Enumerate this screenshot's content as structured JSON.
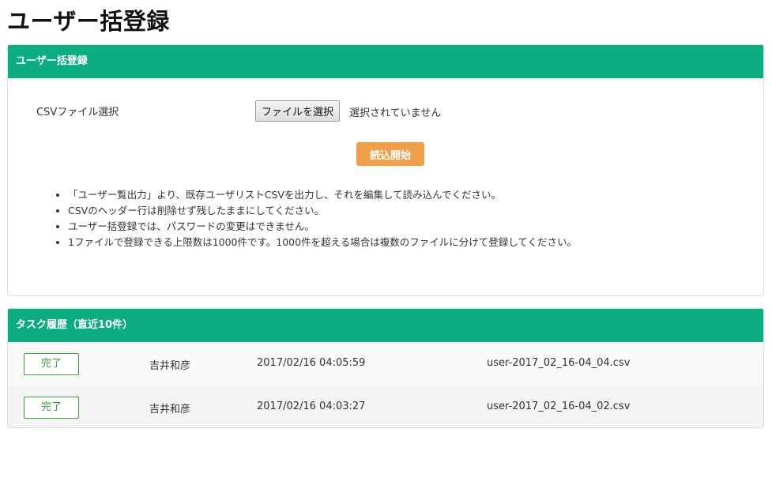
{
  "page_title": "ユーザー括登録",
  "upload_panel": {
    "header": "ユーザー括登録",
    "csv_label": "CSVファイル選択",
    "file_button_label": "ファイルを選択",
    "file_status": "選択されていません",
    "start_button_label": "読込開始",
    "notes": [
      "「ユーザー覧出力」より、既存ユーザリストCSVを出力し、それを編集して読み込んでください。",
      "CSVのヘッダー行は削除せず残したままにしてください。",
      "ユーザー括登録では、パスワードの変更はできません。",
      "1ファイルで登録できる上限数は1000件です。1000件を超える場合は複数のファイルに分けて登録してください。"
    ]
  },
  "history_panel": {
    "header": "タスク履歴（直近10件）",
    "rows": [
      {
        "status": "完了",
        "user": "吉井和彦",
        "time": "2017/02/16 04:05:59",
        "file": "user-2017_02_16-04_04.csv"
      },
      {
        "status": "完了",
        "user": "吉井和彦",
        "time": "2017/02/16 04:03:27",
        "file": "user-2017_02_16-04_02.csv"
      }
    ]
  },
  "colors": {
    "header_green": "#0aac80",
    "start_orange": "#f0a04b",
    "status_green": "#3d9a3d"
  }
}
